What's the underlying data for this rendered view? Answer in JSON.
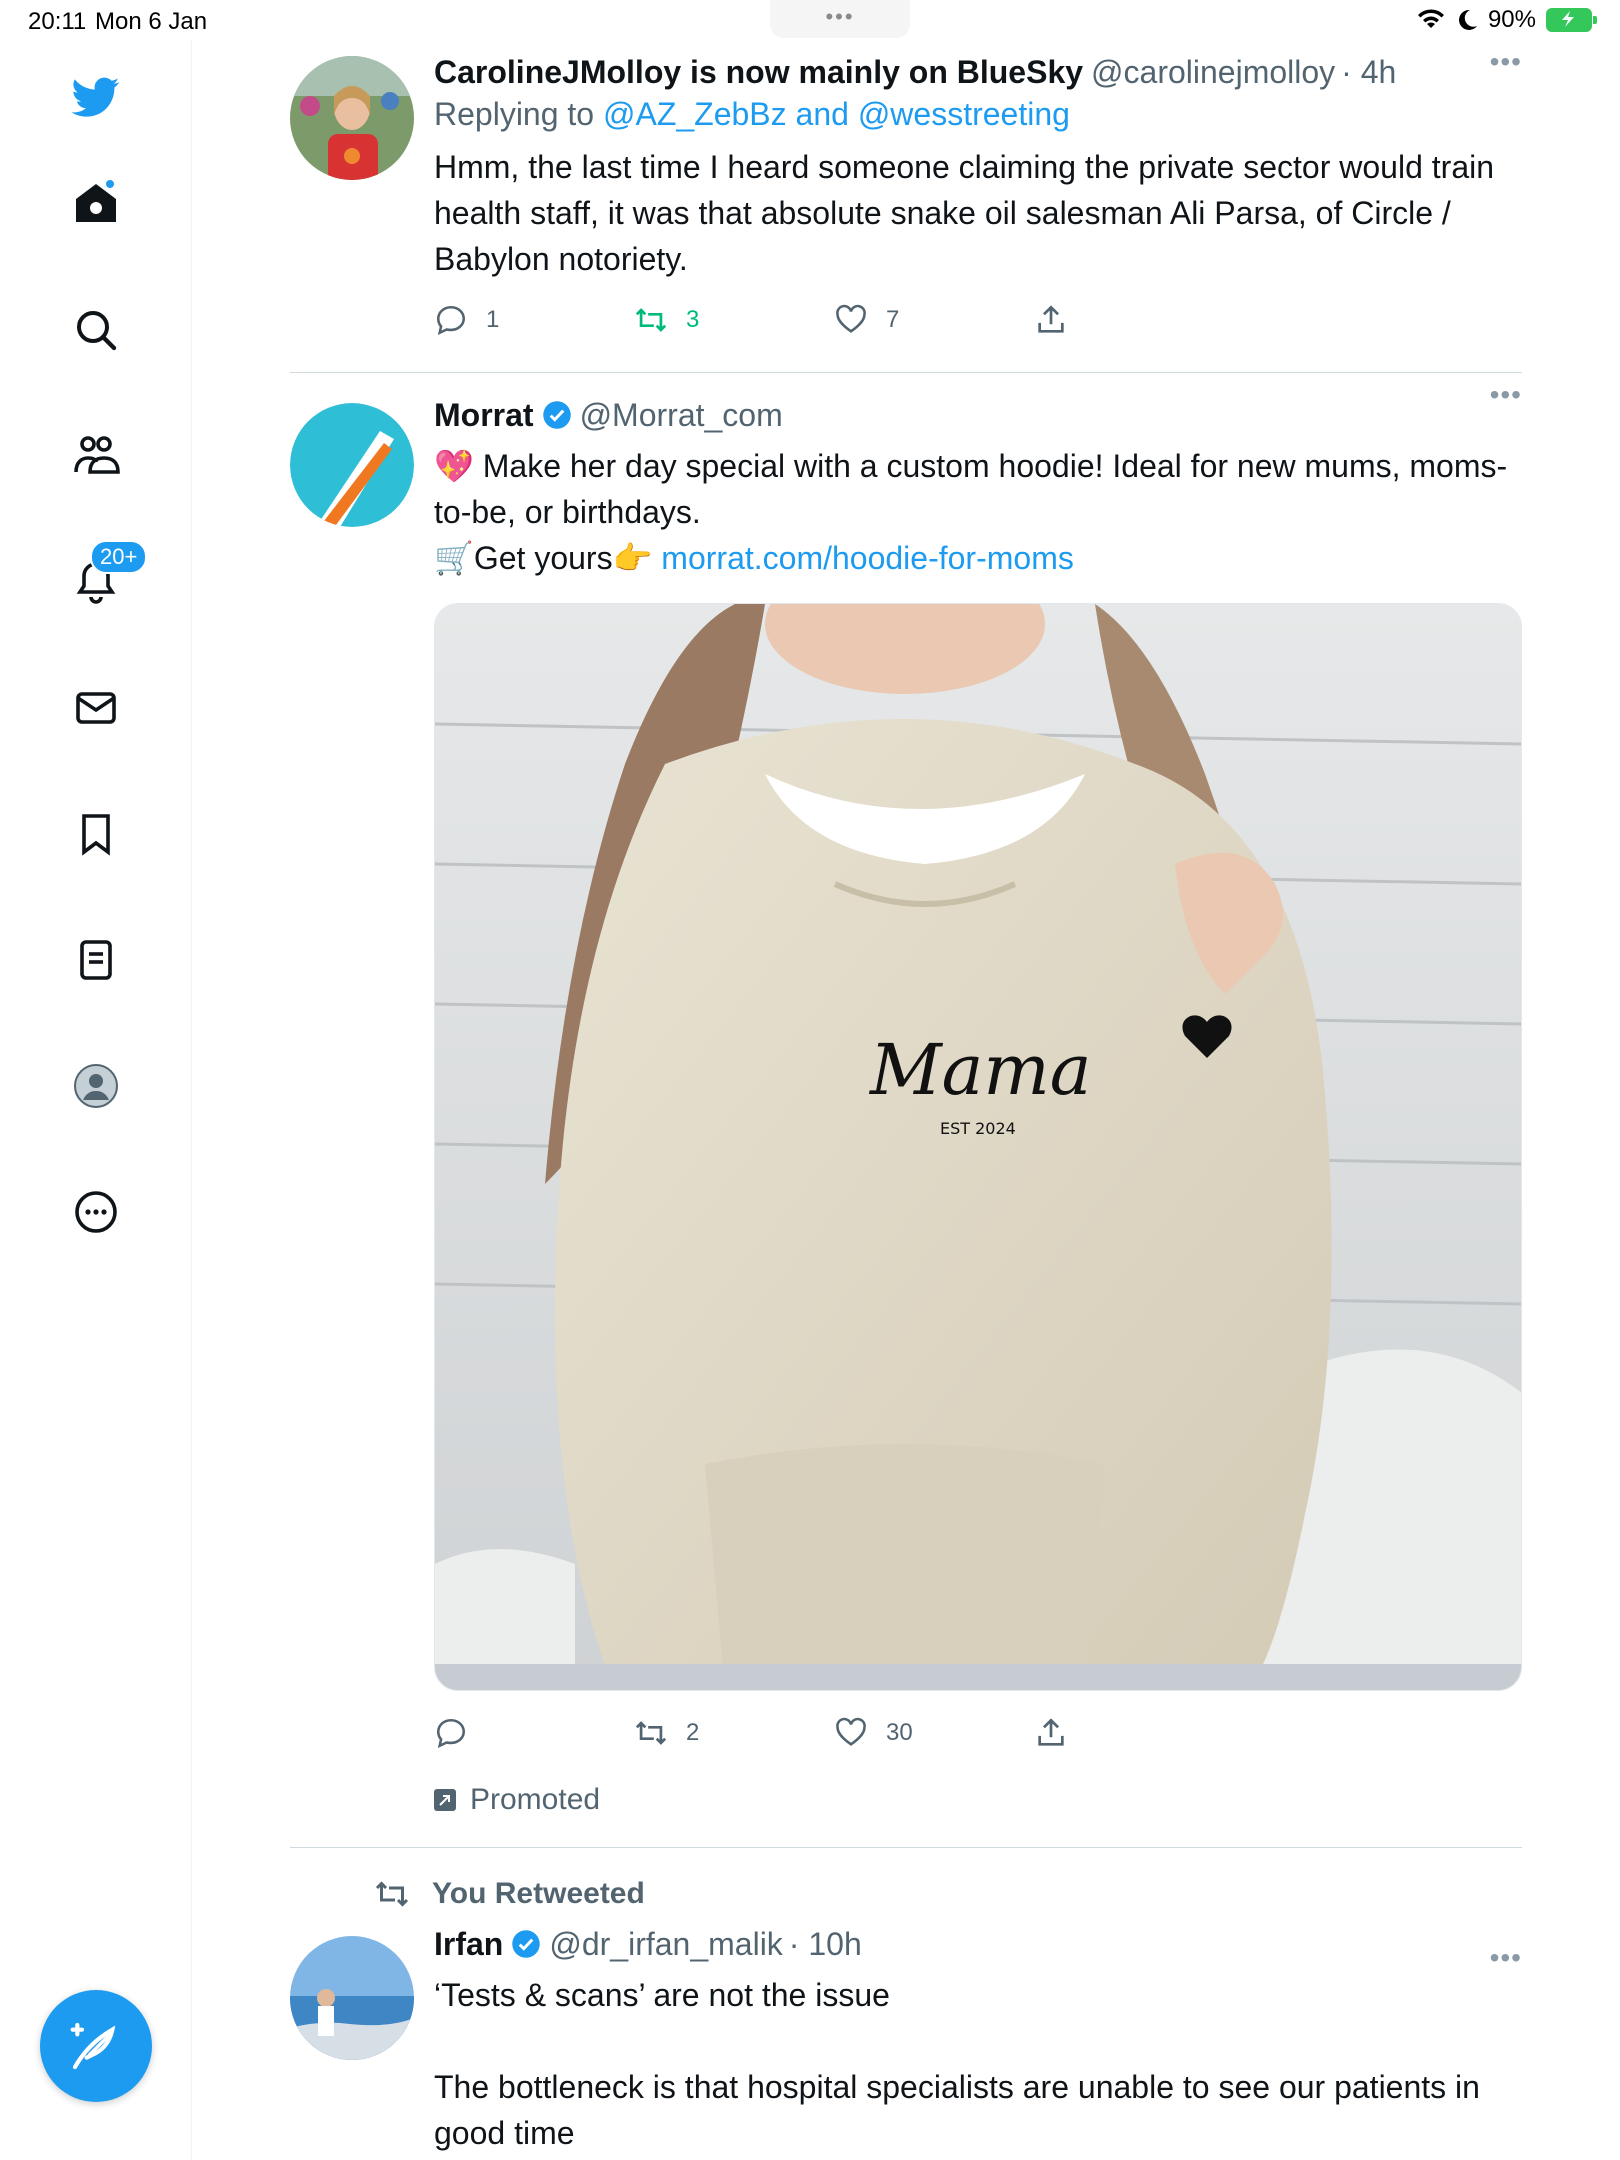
{
  "status_bar": {
    "time": "20:11",
    "date": "Mon 6 Jan",
    "battery": "90%"
  },
  "sidebar": {
    "notifications_badge": "20+"
  },
  "tweets": [
    {
      "name": "CarolineJMolloy is now mainly on BlueSky",
      "handle": "@carolinejmolloy",
      "time": "· 4h",
      "replying_prefix": "Replying to ",
      "replying_to": "@AZ_ZebBz and @wesstreeting",
      "text": "Hmm, the last time I heard someone claiming the private sector would train health staff, it was that absolute snake oil salesman Ali Parsa, of Circle / Babylon notoriety.",
      "replies": "1",
      "retweets": "3",
      "likes": "7"
    },
    {
      "name": "Morrat",
      "handle": "@Morrat_com",
      "text_line1": "💖 Make her day special with a custom hoodie! Ideal for new mums, moms-to-be, or birthdays.",
      "text_line2_prefix": "🛒Get yours👉 ",
      "link": "morrat.com/hoodie-for-moms",
      "image_text_main": "Mama",
      "image_text_sub": "EST 2024",
      "replies": "",
      "retweets": "2",
      "likes": "30",
      "promoted": "Promoted"
    },
    {
      "retweeted_by": "You Retweeted",
      "name": "Irfan",
      "handle": "@dr_irfan_malik",
      "time": "· 10h",
      "text": "‘Tests & scans’ are not the issue\n\nThe bottleneck is that hospital specialists are unable to see our patients in good time"
    }
  ],
  "colors": {
    "accent": "#1d9bf0",
    "retweet_green": "#00ba7c",
    "secondary_text": "#536471"
  }
}
